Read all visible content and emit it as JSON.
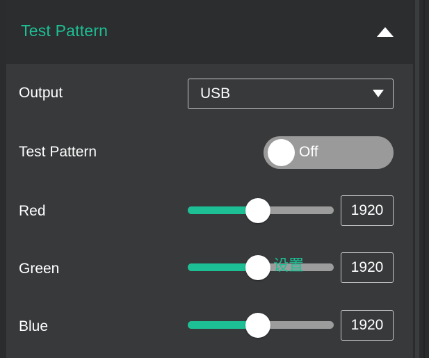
{
  "colors": {
    "accent": "#1dbf94",
    "panel_bg": "#37393b",
    "header_bg": "#2c2d2f",
    "text": "#ffffff",
    "toggle_off": "#9a9a9a"
  },
  "header": {
    "title": "Test Pattern",
    "collapse_icon": "triangle-up-icon"
  },
  "rows": {
    "output": {
      "label": "Output",
      "selected": "USB",
      "caret_icon": "triangle-down-icon"
    },
    "test_pattern": {
      "label": "Test Pattern",
      "state": "Off"
    },
    "red": {
      "label": "Red",
      "value": "1920",
      "slider_fraction": 0.48
    },
    "green": {
      "label": "Green",
      "value": "1920",
      "slider_fraction": 0.48
    },
    "blue": {
      "label": "Blue",
      "value": "1920",
      "slider_fraction": 0.48
    }
  },
  "overlay_text": "设置"
}
